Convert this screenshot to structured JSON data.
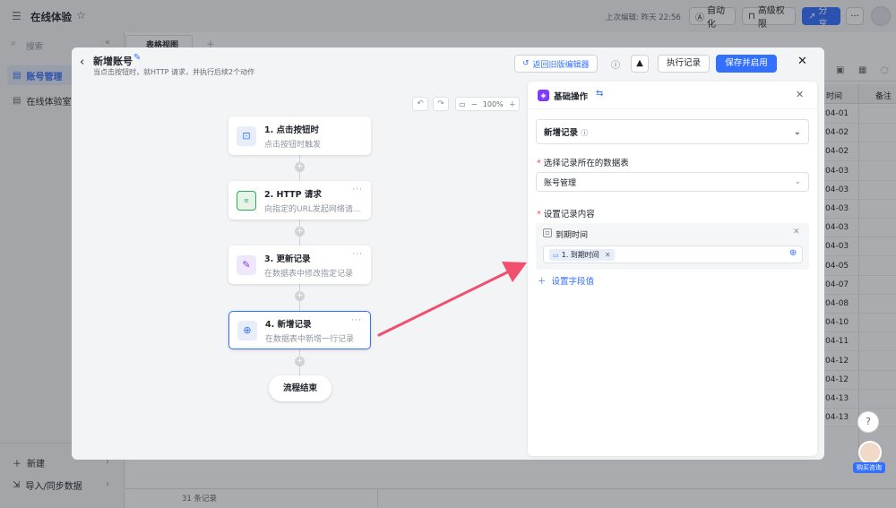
{
  "topbar": {
    "title": "在线体验",
    "last_edit": "上次编辑: 昨天 22:56",
    "automation_label": "自动化",
    "permission_label": "高级权限",
    "share_label": "分享",
    "more": "···"
  },
  "sidebar": {
    "search_placeholder": "搜索",
    "items": [
      {
        "label": "账号管理"
      },
      {
        "label": "在线体验室"
      }
    ],
    "new_label": "新建",
    "import_label": "导入/同步数据"
  },
  "grid": {
    "view_tab": "表格视图",
    "col_time": "时间",
    "col_note": "备注",
    "dates": [
      "04-01",
      "04-02",
      "04-02",
      "04-03",
      "04-03",
      "04-03",
      "04-03",
      "04-03",
      "04-05",
      "04-07",
      "04-08",
      "04-10",
      "04-11",
      "04-12",
      "04-12",
      "04-13",
      "04-13"
    ],
    "record_count": "31 条记录"
  },
  "modal": {
    "title": "新增账号",
    "subtitle": "当点击按钮时，就HTTP 请求，并执行后续2个动作",
    "back_label": "返回旧版编辑器",
    "exec_log": "执行记录",
    "save_enable": "保存并启用",
    "zoom": "100%",
    "nodes": [
      {
        "title": "1. 点击按钮时",
        "desc": "点击按钮时触发"
      },
      {
        "title": "2. HTTP 请求",
        "desc": "向指定的URL发起网络请..."
      },
      {
        "title": "3. 更新记录",
        "desc": "在数据表中修改指定记录"
      },
      {
        "title": "4. 新增记录",
        "desc": "在数据表中新增一行记录"
      }
    ],
    "end_label": "流程结束"
  },
  "panel": {
    "header": "基础操作",
    "action": "新增记录",
    "select_table_label": "选择记录所在的数据表",
    "table_value": "账号管理",
    "content_label": "设置记录内容",
    "field_name": "到期时间",
    "tag_value": "1. 到期时间",
    "add_field": "设置字段值"
  },
  "help": {
    "consult": "购买咨询",
    "question": "?"
  },
  "colors": {
    "primary": "#3370ff",
    "arrow": "#f0506e",
    "http_green": "#34a853",
    "edit_purple": "#7f3bf5"
  }
}
